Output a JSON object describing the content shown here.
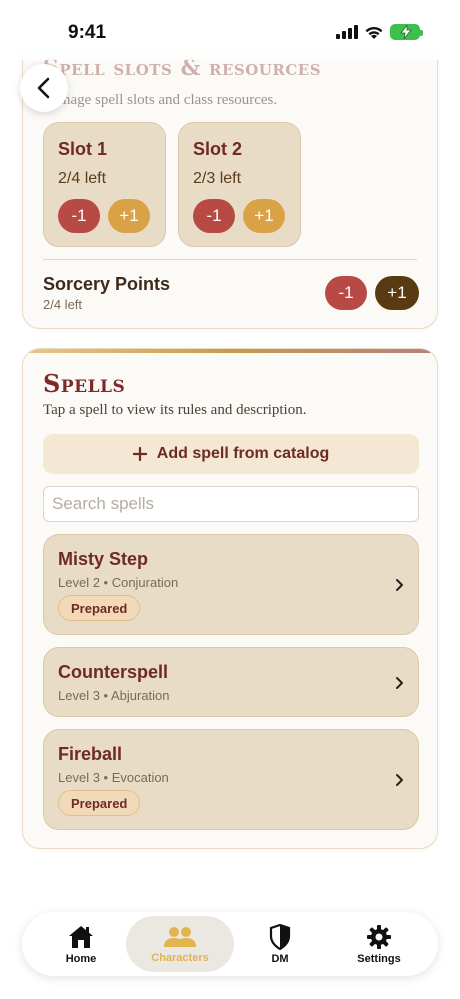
{
  "status": {
    "time": "9:41"
  },
  "slots_section": {
    "title": "Spell slots & resources",
    "subtitle": "Manage spell slots and class resources.",
    "slots": [
      {
        "name": "Slot 1",
        "remaining": "2/4 left",
        "minus": "-1",
        "plus": "+1"
      },
      {
        "name": "Slot 2",
        "remaining": "2/3 left",
        "minus": "-1",
        "plus": "+1"
      }
    ],
    "resource": {
      "name": "Sorcery Points",
      "remaining": "2/4 left",
      "minus": "-1",
      "plus": "+1"
    }
  },
  "spells_section": {
    "title": "Spells",
    "subtitle": "Tap a spell to view its rules and description.",
    "add_label": "Add spell from catalog",
    "search_placeholder": "Search spells",
    "spells": [
      {
        "name": "Misty Step",
        "meta": "Level 2 • Conjuration",
        "badge": "Prepared"
      },
      {
        "name": "Counterspell",
        "meta": "Level 3 • Abjuration"
      },
      {
        "name": "Fireball",
        "meta": "Level 3 • Evocation",
        "badge": "Prepared"
      }
    ]
  },
  "tabbar": {
    "tabs": [
      {
        "label": "Home",
        "icon": "home-icon"
      },
      {
        "label": "Characters",
        "icon": "users-icon",
        "active": true
      },
      {
        "label": "DM",
        "icon": "shield-icon"
      },
      {
        "label": "Settings",
        "icon": "gear-icon"
      }
    ]
  },
  "colors": {
    "accent_red": "#7e2a2a",
    "minus_pill": "#b84a45",
    "plus_pill": "#d9a246",
    "card_bg": "#e9dcc6",
    "active_tab": "#e2b450"
  }
}
